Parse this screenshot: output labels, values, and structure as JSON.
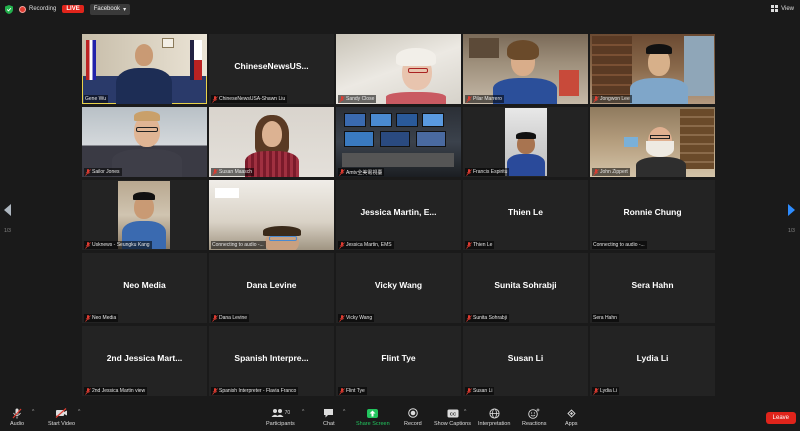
{
  "topbar": {
    "recording_label": "Recording",
    "live_label": "LIVE",
    "stream_target": "Facebook",
    "view_label": "View"
  },
  "nav": {
    "left_page": "1/3",
    "right_page": "1/3"
  },
  "tiles": [
    {
      "label": "Gene Wu",
      "center": ""
    },
    {
      "label": "ChineseNewsUSA-Shawn Liu",
      "center": "ChineseNewsUS..."
    },
    {
      "label": "Sandy Close",
      "center": ""
    },
    {
      "label": "Pilar Marrero",
      "center": ""
    },
    {
      "label": "Jongwon Lee",
      "center": ""
    },
    {
      "label": "Sailor Jones",
      "center": ""
    },
    {
      "label": "Susan Maasch",
      "center": ""
    },
    {
      "label": "Amtv全美電視臺",
      "center": ""
    },
    {
      "label": "Francis Espiritu",
      "center": ""
    },
    {
      "label": "John Zippert",
      "center": ""
    },
    {
      "label": "Usknews - Seungku Kang",
      "center": ""
    },
    {
      "label": "Connecting to audio -...",
      "center": ""
    },
    {
      "label": "Jessica Martin, EMS",
      "center": "Jessica Martin, E..."
    },
    {
      "label": "Thien Le",
      "center": "Thien Le"
    },
    {
      "label": "Connecting to audio -...",
      "center": "Ronnie Chung"
    },
    {
      "label": "Neo Media",
      "center": "Neo Media"
    },
    {
      "label": "Dana Levine",
      "center": "Dana Levine"
    },
    {
      "label": "Vicky Wang",
      "center": "Vicky Wang"
    },
    {
      "label": "Sunita Sohrabji",
      "center": "Sunita Sohrabji"
    },
    {
      "label": "Sera Hahn",
      "center": "Sera Hahn"
    },
    {
      "label": "2nd Jessica Martin view",
      "center": "2nd Jessica Mart..."
    },
    {
      "label": "Spanish Interpreter - Flavia Franco",
      "center": "Spanish Interpre..."
    },
    {
      "label": "Flint Tye",
      "center": "Flint Tye"
    },
    {
      "label": "Susan Li",
      "center": "Susan Li"
    },
    {
      "label": "Lydia Li",
      "center": "Lydia Li"
    }
  ],
  "toolbar": {
    "audio": "Audio",
    "start_video": "Start Video",
    "participants": "Participants",
    "participant_count": "70",
    "chat": "Chat",
    "share_screen": "Share Screen",
    "record": "Record",
    "show_captions": "Show Captions",
    "interpretation": "Interpretation",
    "reactions": "Reactions",
    "apps": "Apps",
    "leave": "Leave"
  },
  "colors": {
    "background": "#1a1a1a",
    "tile": "#232323",
    "live_red": "#e0241b",
    "active_speaker": "#e8d34a",
    "share_green": "#22c55e",
    "nav_blue": "#2d8cff"
  }
}
